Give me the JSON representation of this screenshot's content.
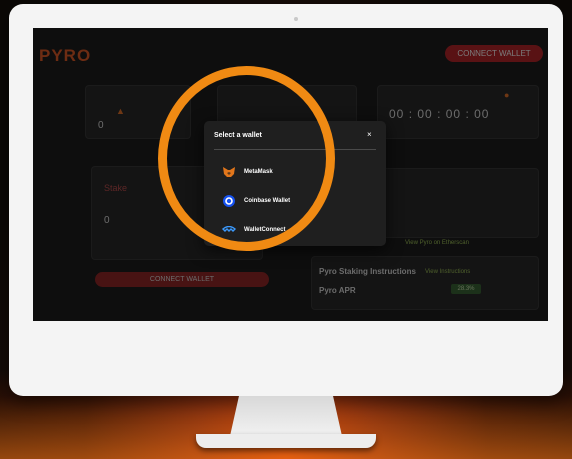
{
  "app": {
    "logo_text": "PYRO",
    "connect_wallet_label": "CONNECT WALLET",
    "stake_label": "Stake",
    "amount_value": "0",
    "card1_value": "0",
    "timer": {
      "hours": "00",
      "minutes": "00",
      "seconds": "00",
      "ms": "00"
    },
    "instructions_label": "Pyro Staking Instructions",
    "instructions_link": "View Instructions",
    "apr_label": "Pyro APR",
    "apr_value": "28.3%",
    "view_link": "View Pyro on Etherscan"
  },
  "modal": {
    "title": "Select a wallet",
    "close_glyph": "×",
    "wallets": [
      {
        "label": "MetaMask",
        "icon": "metamask-fox-icon"
      },
      {
        "label": "Coinbase Wallet",
        "icon": "coinbase-icon"
      },
      {
        "label": "WalletConnect",
        "icon": "walletconnect-icon"
      }
    ]
  },
  "colors": {
    "accent": "#f08a13",
    "brand_red": "#b5171d",
    "modal_bg": "#1f1f1f"
  }
}
